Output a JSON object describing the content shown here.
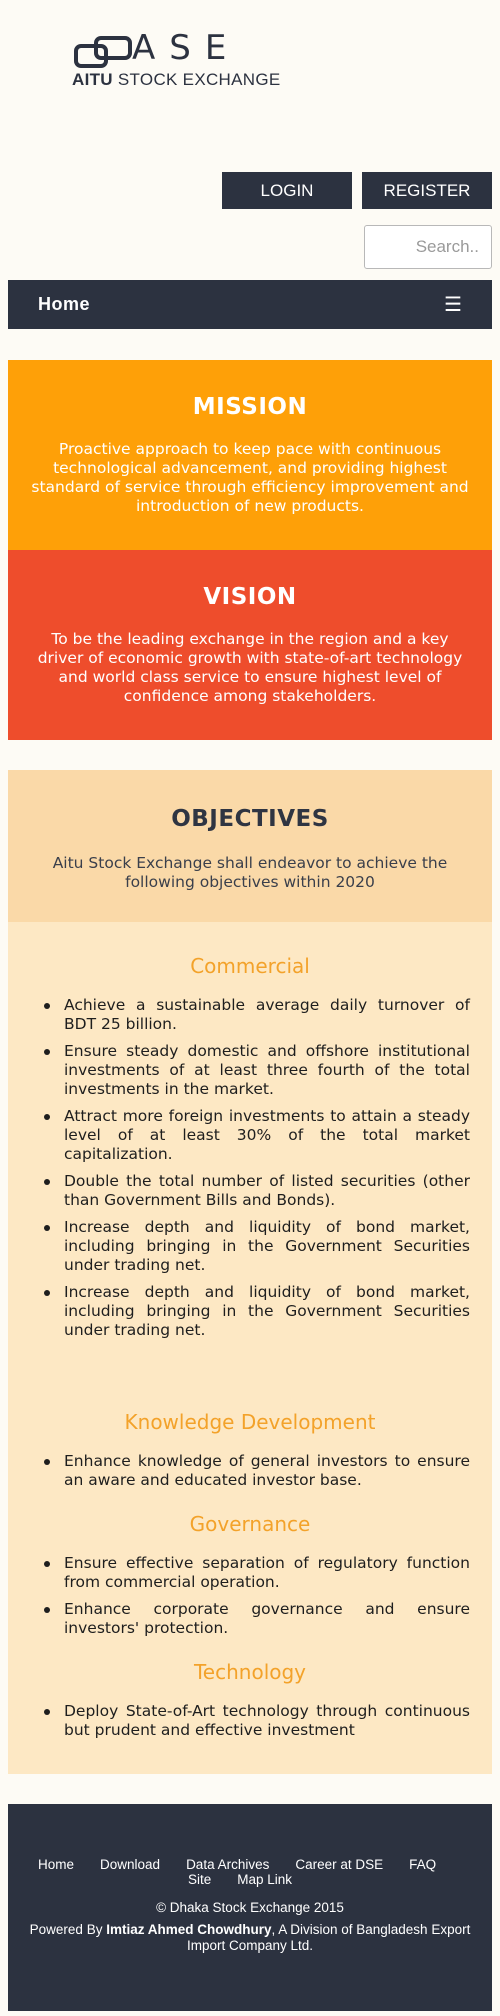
{
  "logo": {
    "letters": "ASE",
    "sub_prefix": "AITU",
    "sub_rest": "STOCK EXCHANGE"
  },
  "header": {
    "login_label": "LOGIN",
    "register_label": "REGISTER",
    "search_placeholder": "Search.."
  },
  "nav": {
    "home_label": "Home",
    "menu_icon": "☰"
  },
  "mission": {
    "title": "MISSION",
    "text": "Proactive approach to keep pace with continuous technological advancement, and providing highest standard of service through efficiency improvement and introduction of new products."
  },
  "vision": {
    "title": "VISION",
    "text": "To be the leading exchange in the region and a key driver of economic growth with state-of-art technology and world class service to ensure highest level of confidence among stakeholders."
  },
  "objectives": {
    "title": "OBJECTIVES",
    "intro": "Aitu Stock Exchange shall endeavor to achieve the following objectives within 2020",
    "sections": [
      {
        "title": "Commercial",
        "items": [
          "Achieve a sustainable average daily turnover of BDT 25 billion.",
          "Ensure steady domestic and offshore institutional investments of at least three fourth of the total investments in the market.",
          "Attract more foreign investments to attain a steady level of at least 30% of the total market capitalization.",
          "Double the total number of listed securities (other than Government Bills and Bonds).",
          "Increase depth and liquidity of bond market, including bringing in the Government Securities under trading net.",
          "Increase depth and liquidity of bond market, including bringing in the Government Securities under trading net."
        ]
      },
      {
        "title": "Knowledge Development",
        "items": [
          "Enhance knowledge of general investors to ensure an aware and educated investor base."
        ]
      },
      {
        "title": "Governance",
        "items": [
          "Ensure effective separation of regulatory function from commercial operation.",
          "Enhance corporate governance and ensure investors' protection."
        ]
      },
      {
        "title": "Technology",
        "items": [
          "Deploy State-of-Art technology through continuous but prudent and effective investment"
        ]
      }
    ]
  },
  "footer": {
    "links": [
      "Home",
      "Download",
      "Data Archives",
      "Career at DSE",
      "FAQ",
      "Site",
      "Map Link"
    ],
    "copyright": "© Dhaka Stock Exchange 2015",
    "powered_prefix": "Powered By ",
    "powered_name": "Imtiaz Ahmed Chowdhury",
    "powered_suffix": ", A Division of Bangladesh Export Import Company Ltd."
  },
  "colors": {
    "dark": "#2c3240",
    "mission": "#fea008",
    "vision": "#ee4d2c",
    "objectives_head": "#fad9a8",
    "objectives_body": "#fde8c4",
    "section_title": "#f3a22a"
  }
}
